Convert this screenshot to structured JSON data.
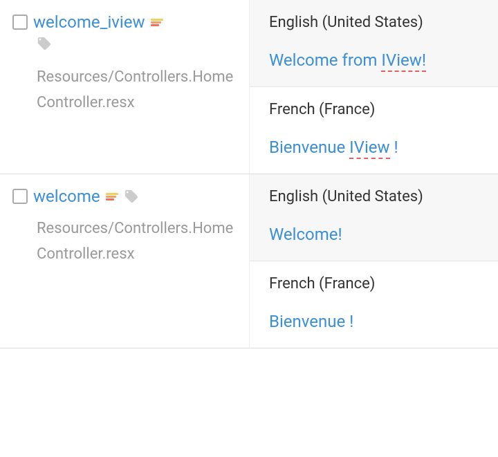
{
  "items": [
    {
      "key": "welcome_iview",
      "path": "Resources/Controllers.HomeController.resx",
      "translations": [
        {
          "locale": "English (United States)",
          "value_pre": "Welcome from ",
          "value_flag": "IView!",
          "value_post": "",
          "alt": true
        },
        {
          "locale": "French (France)",
          "value_pre": "Bienvenue ",
          "value_flag": "IView",
          "value_post": " !",
          "alt": false
        }
      ]
    },
    {
      "key": "welcome",
      "path": "Resources/Controllers.HomeController.resx",
      "translations": [
        {
          "locale": "English (United States)",
          "value_pre": "Welcome!",
          "value_flag": "",
          "value_post": "",
          "alt": true
        },
        {
          "locale": "French (France)",
          "value_pre": "Bienvenue !",
          "value_flag": "",
          "value_post": "",
          "alt": false
        }
      ]
    }
  ]
}
